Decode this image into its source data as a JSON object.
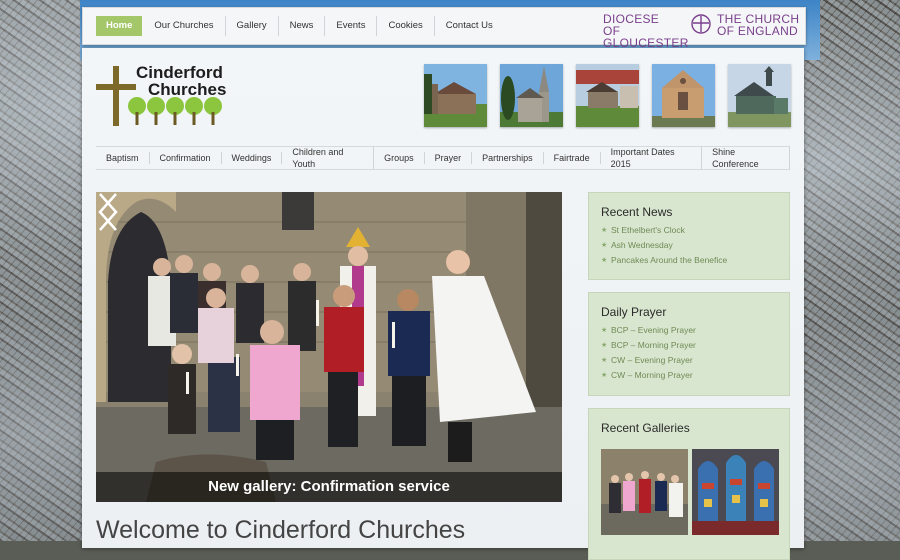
{
  "topnav": {
    "items": [
      {
        "label": "Home",
        "active": true
      },
      {
        "label": "Our Churches"
      },
      {
        "label": "Gallery"
      },
      {
        "label": "News"
      },
      {
        "label": "Events"
      },
      {
        "label": "Cookies"
      },
      {
        "label": "Contact Us"
      }
    ]
  },
  "branding": {
    "diocese_line1": "DIOCESE OF",
    "diocese_line2": "GLOUCESTER",
    "coe_line1": "THE CHURCH",
    "coe_line2": "OF ENGLAND",
    "logo_line1": "Cinderford",
    "logo_line2": "Churches",
    "accent_color": "#a4c76a",
    "diocese_color": "#7a3f8c"
  },
  "church_thumbnails": [
    "church-photo-1",
    "church-photo-2",
    "church-photo-3",
    "church-photo-4",
    "church-photo-5"
  ],
  "mainnav": {
    "items": [
      "Baptism",
      "Confirmation",
      "Weddings",
      "Children and Youth",
      "Groups",
      "Prayer",
      "Partnerships",
      "Fairtrade",
      "Important Dates 2015",
      "Shine Conference"
    ]
  },
  "slider": {
    "caption": "New gallery: Confirmation service"
  },
  "welcome_title": "Welcome to Cinderford Churches",
  "recent_news": {
    "title": "Recent News",
    "items": [
      "St Ethelbert's Clock",
      "Ash Wednesday",
      "Pancakes Around the Benefice"
    ]
  },
  "daily_prayer": {
    "title": "Daily Prayer",
    "items": [
      "BCP – Evening Prayer",
      "BCP – Morning Prayer",
      "CW – Evening Prayer",
      "CW – Morning Prayer"
    ]
  },
  "recent_galleries": {
    "title": "Recent Galleries"
  }
}
